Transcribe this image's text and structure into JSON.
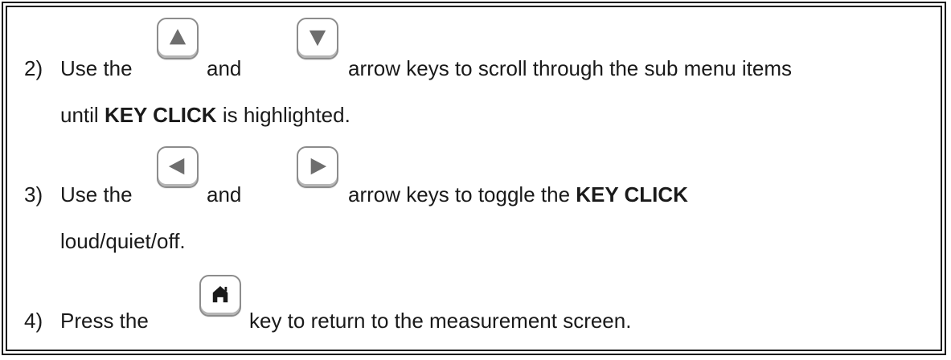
{
  "steps": [
    {
      "number": "2)",
      "line1": {
        "use": "Use the",
        "and": "and",
        "rest": "arrow keys to scroll through the sub menu items"
      },
      "line2": {
        "pre": "until",
        "bold": "KEY CLICK",
        "post": "is highlighted."
      },
      "keys": [
        "up-arrow-key",
        "down-arrow-key"
      ]
    },
    {
      "number": "3)",
      "line1": {
        "use": "Use the",
        "and": "and",
        "rest": "arrow keys to toggle the",
        "bold": "KEY CLICK"
      },
      "line2": {
        "text": "loud/quiet/off."
      },
      "keys": [
        "left-arrow-key",
        "right-arrow-key"
      ]
    },
    {
      "number": "4)",
      "line1": {
        "use": "Press the",
        "rest": "key to return to the measurement screen."
      },
      "keys": [
        "home-key"
      ]
    }
  ],
  "colors": {
    "text": "#1a1a1a",
    "border": "#111111",
    "key_outline": "#8c8c8c",
    "glyph": "#6e6e6e",
    "home_glyph": "#1a1a1a"
  }
}
